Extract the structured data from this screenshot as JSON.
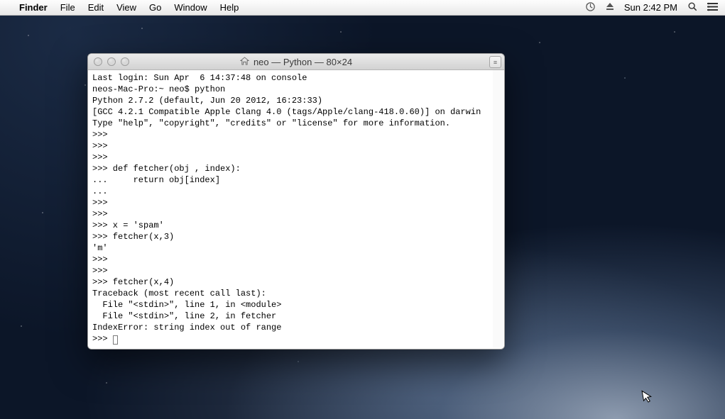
{
  "menubar": {
    "app": "Finder",
    "items": [
      "File",
      "Edit",
      "View",
      "Go",
      "Window",
      "Help"
    ],
    "clock": "Sun 2:42 PM"
  },
  "window": {
    "title": "neo — Python — 80×24"
  },
  "terminal": {
    "lines": [
      "Last login: Sun Apr  6 14:37:48 on console",
      "neos-Mac-Pro:~ neo$ python",
      "Python 2.7.2 (default, Jun 20 2012, 16:23:33) ",
      "[GCC 4.2.1 Compatible Apple Clang 4.0 (tags/Apple/clang-418.0.60)] on darwin",
      "Type \"help\", \"copyright\", \"credits\" or \"license\" for more information.",
      ">>> ",
      ">>> ",
      ">>> ",
      ">>> def fetcher(obj , index):",
      "...     return obj[index]",
      "... ",
      ">>> ",
      ">>> ",
      ">>> x = 'spam'",
      ">>> fetcher(x,3)",
      "'m'",
      ">>> ",
      ">>> ",
      ">>> fetcher(x,4)",
      "Traceback (most recent call last):",
      "  File \"<stdin>\", line 1, in <module>",
      "  File \"<stdin>\", line 2, in fetcher",
      "IndexError: string index out of range",
      ">>> "
    ]
  }
}
